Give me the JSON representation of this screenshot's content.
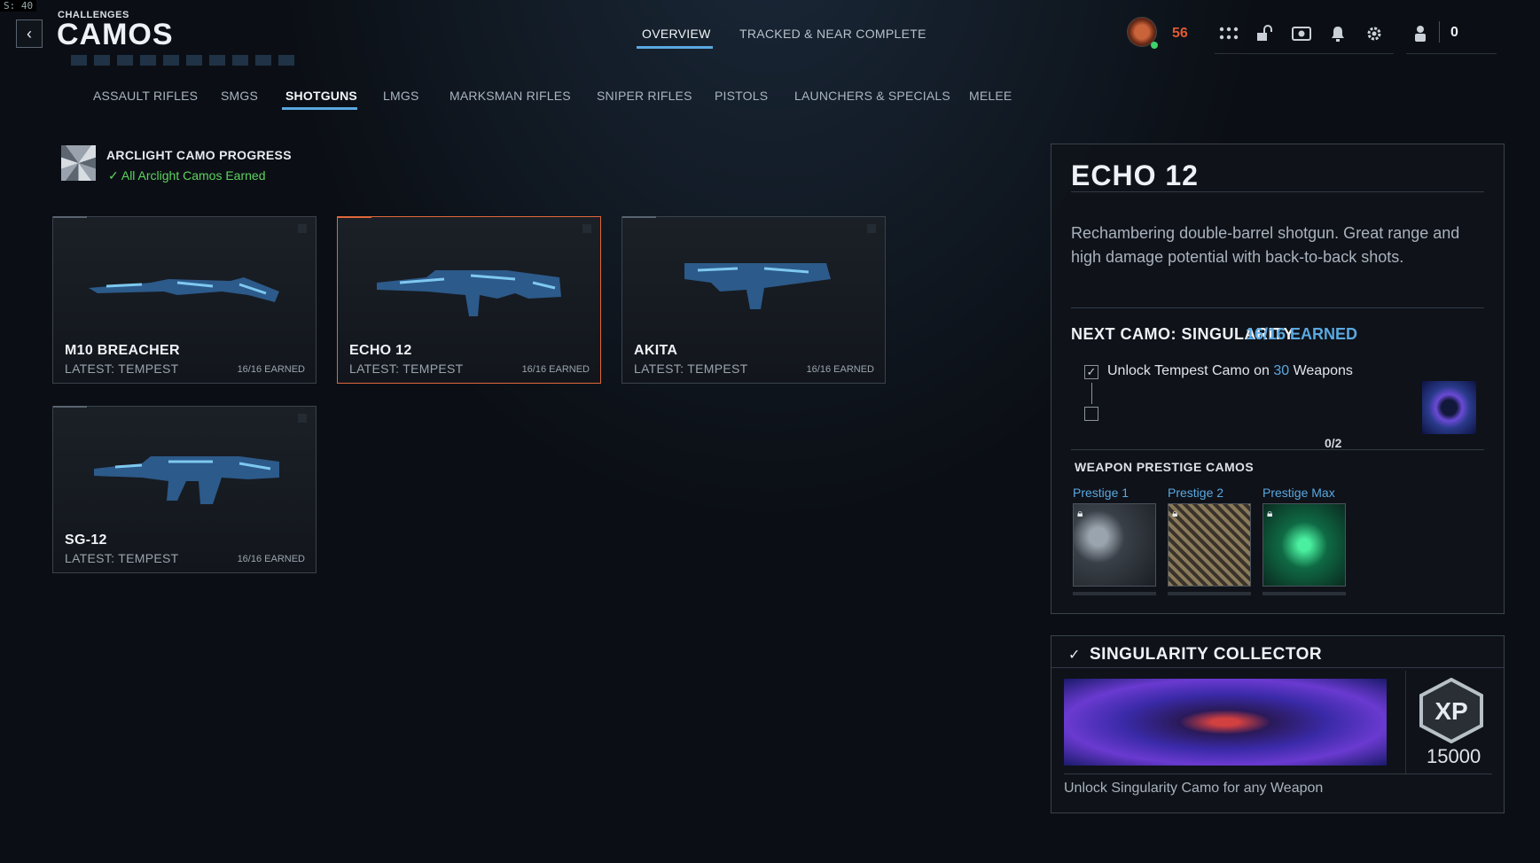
{
  "fps": "S: 40",
  "header": {
    "breadcrumb": "CHALLENGES",
    "title": "CAMOS",
    "tabs": [
      {
        "label": "OVERVIEW",
        "active": true
      },
      {
        "label": "TRACKED & NEAR COMPLETE",
        "active": false
      }
    ],
    "player_level": "56",
    "currency_count": "0",
    "icons": [
      "apps-grid-icon",
      "unlock-icon",
      "media-icon",
      "bell-icon",
      "gear-icon",
      "friends-icon"
    ]
  },
  "categories": [
    {
      "label": "ASSAULT RIFLES",
      "active": false
    },
    {
      "label": "SMGS",
      "active": false
    },
    {
      "label": "SHOTGUNS",
      "active": true
    },
    {
      "label": "LMGS",
      "active": false
    },
    {
      "label": "MARKSMAN RIFLES",
      "active": false
    },
    {
      "label": "SNIPER RIFLES",
      "active": false
    },
    {
      "label": "PISTOLS",
      "active": false
    },
    {
      "label": "LAUNCHERS & SPECIALS",
      "active": false
    },
    {
      "label": "MELEE",
      "active": false
    }
  ],
  "arclight": {
    "title": "ARCLIGHT CAMO PROGRESS",
    "status": "All Arclight Camos Earned"
  },
  "weapons": [
    {
      "name": "M10 BREACHER",
      "latest": "LATEST: TEMPEST",
      "earned": "16/16 EARNED",
      "selected": false
    },
    {
      "name": "ECHO 12",
      "latest": "LATEST: TEMPEST",
      "earned": "16/16 EARNED",
      "selected": true
    },
    {
      "name": "AKITA",
      "latest": "LATEST: TEMPEST",
      "earned": "16/16 EARNED",
      "selected": false
    },
    {
      "name": "SG-12",
      "latest": "LATEST: TEMPEST",
      "earned": "16/16 EARNED",
      "selected": false
    }
  ],
  "detail": {
    "title": "ECHO 12",
    "description": "Rechambering double-barrel shotgun. Great range and high damage potential with back-to-back shots.",
    "next_camo_label": "NEXT CAMO: SINGULARITY",
    "next_camo_earned": "16/16 EARNED",
    "challenge": {
      "prefix": "Unlock Tempest Camo on ",
      "count": "30",
      "suffix": " Weapons",
      "progress": "0/2",
      "checked": true
    },
    "prestige_title": "WEAPON PRESTIGE CAMOS",
    "prestige": [
      {
        "label": "Prestige 1",
        "locked": true,
        "color": "#6b7480"
      },
      {
        "label": "Prestige 2",
        "locked": true,
        "color": "#8a7a5a"
      },
      {
        "label": "Prestige Max",
        "locked": true,
        "color": "#1aa86a"
      }
    ]
  },
  "collector": {
    "title": "SINGULARITY COLLECTOR",
    "xp_label": "XP",
    "xp_amount": "15000",
    "description": "Unlock Singularity Camo for any Weapon"
  },
  "colors": {
    "accent_blue": "#5aa8e0",
    "selected_orange": "#e0673a",
    "success_green": "#5ed35e",
    "level_red": "#e05a33"
  }
}
